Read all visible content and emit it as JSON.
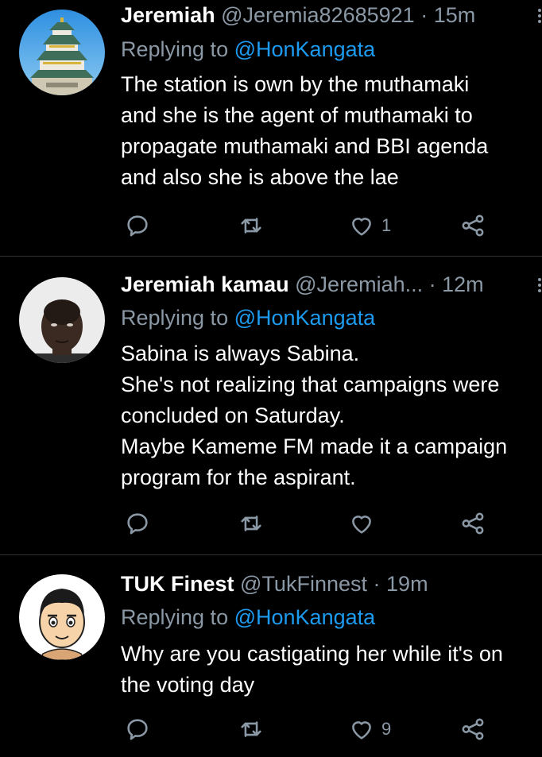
{
  "tweets": [
    {
      "name": "Jeremiah",
      "handle": "@Jeremia82685921",
      "separator": "·",
      "time": "15m",
      "replying_prefix": "Replying to",
      "replying_to": "@HonKangata",
      "lines": [
        "The station is own by the muthamaki",
        "and she is the agent of muthamaki to",
        "propagate muthamaki and BBI agenda",
        "and also she is above the lae"
      ],
      "likes": "1"
    },
    {
      "name": "Jeremiah kamau",
      "handle": "@Jeremiah...",
      "separator": "·",
      "time": "12m",
      "replying_prefix": "Replying to",
      "replying_to": "@HonKangata",
      "lines": [
        "Sabina is always Sabina.",
        "She's not realizing that campaigns were",
        "concluded on Saturday.",
        "Maybe Kameme FM made it a campaign",
        "program for the aspirant."
      ],
      "likes": ""
    },
    {
      "name": "TUK Finest",
      "handle": "@TukFinnest",
      "separator": "·",
      "time": "19m",
      "replying_prefix": "Replying to",
      "replying_to": "@HonKangata",
      "lines": [
        "Why are you castigating her while it's on",
        "the voting day"
      ],
      "likes": "9"
    }
  ],
  "icons": {
    "reply": "reply-icon",
    "retweet": "retweet-icon",
    "like": "heart-icon",
    "share": "share-icon",
    "more": "more-icon"
  },
  "colors": {
    "background": "#000000",
    "text": "#ffffff",
    "secondary": "#8b98a5",
    "link": "#1d9bf0",
    "divider": "#2f3336"
  }
}
